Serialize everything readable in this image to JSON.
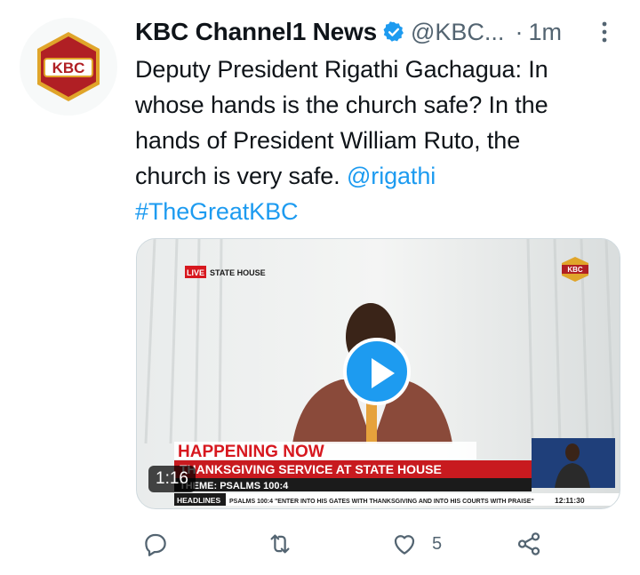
{
  "tweet": {
    "author_name": "KBC Channel1 News",
    "handle": "@KBC...",
    "separator": "·",
    "time": "1m",
    "text_lines": [
      "Deputy President Rigathi Gachagua: In",
      "whose hands is the church safe? In the",
      "hands of President William Ruto, the",
      "church is very safe."
    ],
    "mention": "@rigathi",
    "hashtag": "#TheGreatKBC"
  },
  "avatar": {
    "logo_text": "KBC"
  },
  "media": {
    "duration": "1:16",
    "live_badge": "LIVE",
    "location": "STATE HOUSE",
    "channel_logo": "KBC",
    "banner_title": "HAPPENING NOW",
    "banner_headline": "THANKSGIVING SERVICE AT STATE HOUSE",
    "banner_theme": "THEME: PSALMS 100:4",
    "ticker_label": "HEADLINES",
    "ticker_text": "PSALMS 100:4 \"ENTER INTO HIS GATES WITH THANKSGIVING AND INTO HIS COURTS WITH PRAISE\"",
    "ticker_time": "12:11:30"
  },
  "actions": {
    "reply_icon": "reply-icon",
    "retweet_icon": "retweet-icon",
    "like_icon": "heart-icon",
    "like_count": "5",
    "share_icon": "share-icon"
  },
  "colors": {
    "accent": "#1d9bf0",
    "text": "#0f1419",
    "secondary": "#536471",
    "banner_red": "#d7181f"
  }
}
